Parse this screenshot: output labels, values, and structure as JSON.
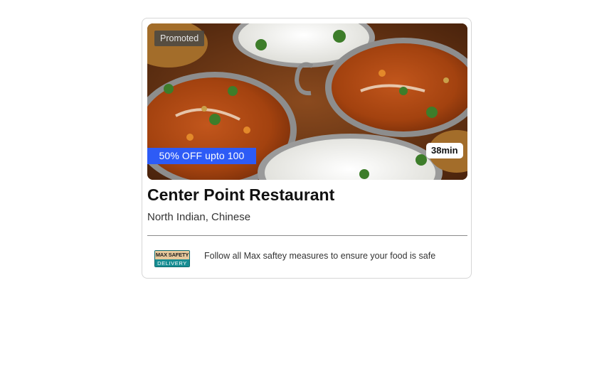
{
  "card": {
    "promoted_label": "Promoted",
    "offer_label": "50% OFF upto 100",
    "delivery_time": "38min",
    "restaurant_name": "Center Point Restaurant",
    "cuisines": "North Indian, Chinese",
    "safety_badge": {
      "top_text": "MAX SAFETY",
      "bottom_text": "DELIVERY"
    },
    "safety_message": "Follow all Max saftey measures to ensure your food is safe"
  },
  "colors": {
    "offer_bg": "#2d5bf6",
    "badge_teal": "#168d92",
    "badge_tan": "#e7c89b"
  },
  "icons": {
    "hero_image": "food-photo",
    "badge": "max-safety-delivery-badge"
  }
}
